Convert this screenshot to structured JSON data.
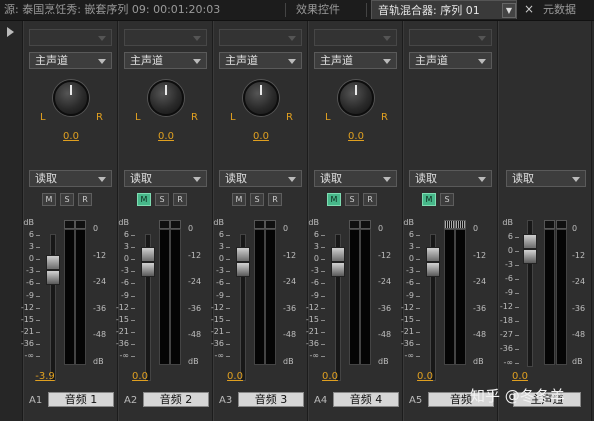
{
  "tabs": {
    "source": "源: 泰国烹饪秀: 嵌套序列 09: 00:01:20:03",
    "effects": "效果控件",
    "mixer": "音轨混合器: 序列 01",
    "metadata": "元数据"
  },
  "close_glyph": "×",
  "scale_labels": [
    "dB",
    "6",
    "3",
    "0",
    "-3",
    "-6",
    "-9",
    "-12",
    "-15",
    "-21",
    "-36",
    "-∞"
  ],
  "master_scale_labels": [
    "dB",
    "6",
    "0",
    "-3",
    "-6",
    "-9",
    "-12",
    "-18",
    "-27",
    "-36",
    "-∞"
  ],
  "meter_scale_labels": [
    "0",
    "-12",
    "-24",
    "-36",
    "-48",
    "dB"
  ],
  "channels": [
    {
      "id": "A1",
      "name": "音频 1",
      "output": "主声道",
      "automation": "读取",
      "pan": "0.0",
      "volume": "-3.9",
      "mute": false,
      "solo": false,
      "record": false,
      "has_record": true
    },
    {
      "id": "A2",
      "name": "音频 2",
      "output": "主声道",
      "automation": "读取",
      "pan": "0.0",
      "volume": "0.0",
      "mute": true,
      "solo": false,
      "record": false,
      "has_record": true
    },
    {
      "id": "A3",
      "name": "音频 3",
      "output": "主声道",
      "automation": "读取",
      "pan": "0.0",
      "volume": "0.0",
      "mute": false,
      "solo": false,
      "record": false,
      "has_record": true
    },
    {
      "id": "A4",
      "name": "音频 4",
      "output": "主声道",
      "automation": "读取",
      "pan": "0.0",
      "volume": "0.0",
      "mute": true,
      "solo": false,
      "record": false,
      "has_record": true
    },
    {
      "id": "A5",
      "name": "音频",
      "output": "主声道",
      "automation": "读取",
      "pan": null,
      "volume": "0.0",
      "mute": true,
      "solo": false,
      "record": false,
      "has_record": false
    }
  ],
  "master": {
    "name": "主声道",
    "automation": "读取",
    "volume": "0.0"
  },
  "pan_left": "L",
  "pan_right": "R",
  "button_labels": {
    "mute": "M",
    "solo": "S",
    "record": "R"
  },
  "watermark": "知乎 @冬冬羊",
  "colors": {
    "accent": "#e0a020",
    "mute_on": "#47b88a"
  }
}
